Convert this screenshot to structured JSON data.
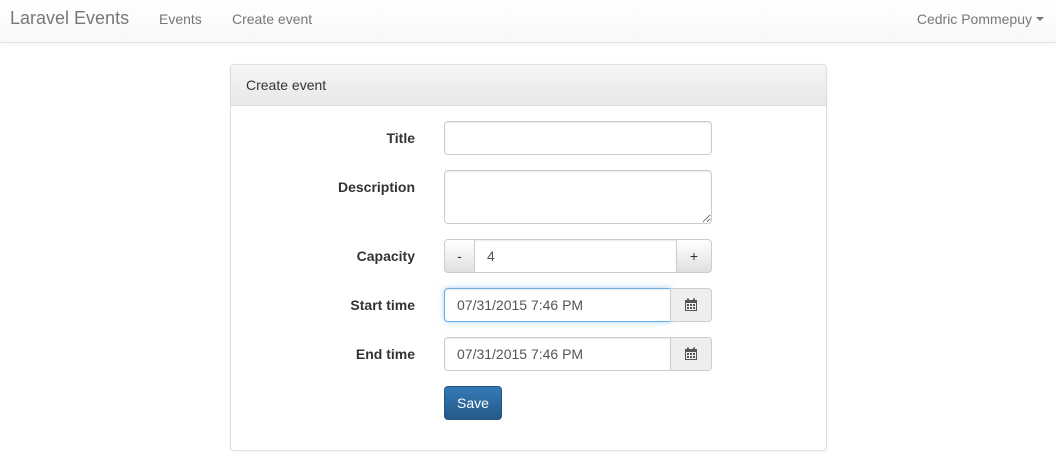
{
  "navbar": {
    "brand": "Laravel Events",
    "links": [
      "Events",
      "Create event"
    ],
    "user": "Cedric Pommepuy"
  },
  "panel": {
    "heading": "Create event"
  },
  "form": {
    "title_label": "Title",
    "title_value": "",
    "description_label": "Description",
    "description_value": "",
    "capacity_label": "Capacity",
    "capacity_minus": "-",
    "capacity_value": "4",
    "capacity_plus": "+",
    "start_label": "Start time",
    "start_value": "07/31/2015 7:46 PM",
    "end_label": "End time",
    "end_value": "07/31/2015 7:46 PM",
    "save_label": "Save"
  },
  "icons": {
    "calendar": "calendar-icon",
    "caret": "caret-down-icon"
  },
  "colors": {
    "primary": "#337ab7",
    "focus": "#66afe9"
  }
}
